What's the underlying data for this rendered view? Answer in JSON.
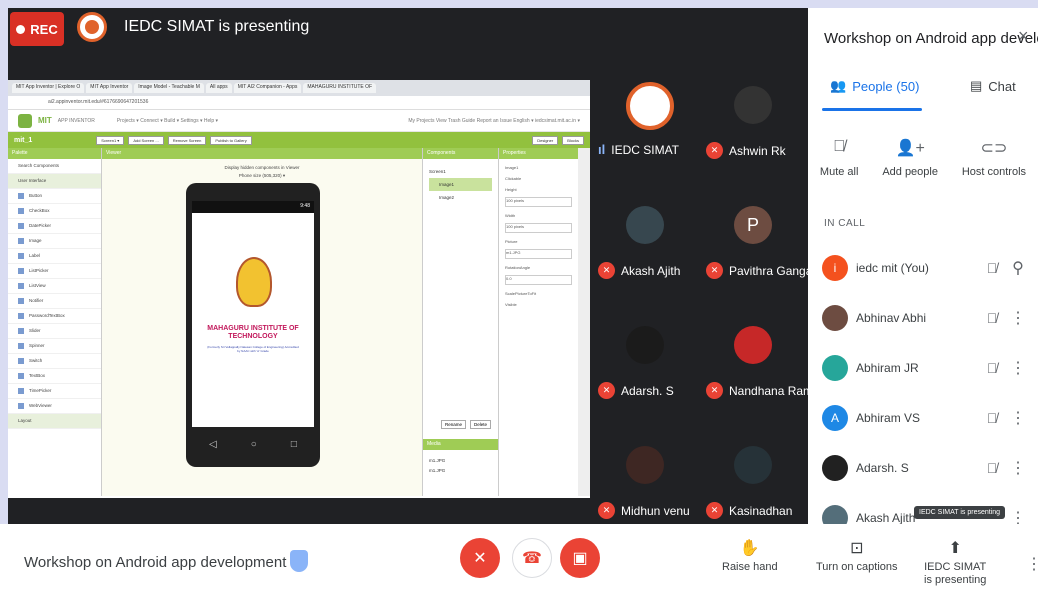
{
  "header": {
    "rec_label": "REC",
    "presenting_text": "IEDC SIMAT is presenting"
  },
  "browser": {
    "tabs": [
      "MIT App Inventor | Explore O",
      "MIT App Inventor",
      "Image Model - Teachable M",
      "All apps",
      "MIT AI2 Companion - Apps",
      "MAHAGURU INSTITUTE OF"
    ],
    "url": "ai2.appinventor.mit.edu/#6176690647201536"
  },
  "app_inventor": {
    "brand": "MIT",
    "brand_sub": "APP INVENTOR",
    "menus": "Projects ▾   Connect ▾   Build ▾   Settings ▾   Help ▾",
    "right_menus": "My Projects   View Trash   Guide   Report an Issue   English ▾   iedcsimat.mit.ac.in ▾",
    "project": "mit_1",
    "buttons": [
      "Screen1 ▾",
      "Add Screen ...",
      "Remove Screen",
      "Publish to Gallery"
    ],
    "mode_buttons": [
      "Designer",
      "Blocks"
    ],
    "palette_title": "Palette",
    "palette_search": "Search Components",
    "palette_group": "User Interface",
    "palette_items": [
      "Button",
      "CheckBox",
      "DatePicker",
      "Image",
      "Label",
      "ListPicker",
      "ListView",
      "Notifier",
      "PasswordTextBox",
      "Slider",
      "Spinner",
      "Switch",
      "TextBox",
      "TimePicker",
      "WebViewer"
    ],
    "palette_layout": "Layout",
    "viewer_title": "Viewer",
    "viewer_checkbox": "Display hidden components in Viewer",
    "viewer_size": "Phone size (505,320) ▾",
    "phone_time": "9:48",
    "institute_name": "MAHAGURU INSTITUTE OF TECHNOLOGY",
    "institute_sub": "(Formerly Sri Vellappally Natesan College of Engineering) Accredited by NAAC with 'A' Grade",
    "components_title": "Components",
    "components": [
      "Screen1",
      "Image1",
      "Image2"
    ],
    "rename_delete": [
      "Rename",
      "Delete"
    ],
    "media_title": "Media",
    "media": [
      "m1.JPG",
      "m1.JPG"
    ],
    "properties_title": "Properties",
    "properties": {
      "component": "Image1",
      "labels": [
        "Clickable",
        "Height",
        "Width",
        "Picture",
        "RotationAngle",
        "ScalePictureToFit",
        "Visible"
      ],
      "height": "100 pixels",
      "width": "100 pixels",
      "picture": "m1.JPG",
      "rotation": "0.0"
    }
  },
  "tiles": [
    {
      "name": "IEDC SIMAT",
      "muted": false
    },
    {
      "name": "Ashwin Rk",
      "muted": true
    },
    {
      "name": "Akash Ajith",
      "muted": true
    },
    {
      "name": "Pavithra Ganga...",
      "muted": true,
      "initial": "P"
    },
    {
      "name": "Adarsh. S",
      "muted": true
    },
    {
      "name": "Nandhana Ram...",
      "muted": true
    },
    {
      "name": "Midhun venu",
      "muted": true
    },
    {
      "name": "Kasinadhan",
      "muted": true
    }
  ],
  "panel": {
    "title": "Workshop on Android app develo...",
    "close_icon": "×",
    "tab_people": "People (50)",
    "tab_chat": "Chat",
    "actions": [
      {
        "label": "Mute all",
        "icon": "mic-off-icon"
      },
      {
        "label": "Add people",
        "icon": "add-person-icon"
      },
      {
        "label": "Host controls",
        "icon": "toggle-icon"
      }
    ],
    "in_call_label": "IN CALL",
    "people": [
      {
        "name": "iedc mit (You)",
        "initial": "i",
        "color": "#f4511e"
      },
      {
        "name": "Abhinav Abhi",
        "initial": "",
        "color": "#6d4c41"
      },
      {
        "name": "Abhiram JR",
        "initial": "",
        "color": "#26a69a"
      },
      {
        "name": "Abhiram VS",
        "initial": "A",
        "color": "#1e88e5"
      },
      {
        "name": "Adarsh. S",
        "initial": "",
        "color": "#212121"
      },
      {
        "name": "Akash Ajith",
        "initial": "",
        "color": "#546e7a"
      }
    ],
    "tooltip": "IEDC SIMAT is presenting"
  },
  "bottom": {
    "meeting_title": "Workshop on Android app development",
    "raise_hand": "Raise hand",
    "captions": "Turn on captions",
    "presenting_line1": "IEDC SIMAT",
    "presenting_line2": "is presenting"
  },
  "colors": {
    "accent": "#1a73e8",
    "danger": "#ea4335",
    "app_green": "#92c13e",
    "meet_dark": "#202124"
  }
}
